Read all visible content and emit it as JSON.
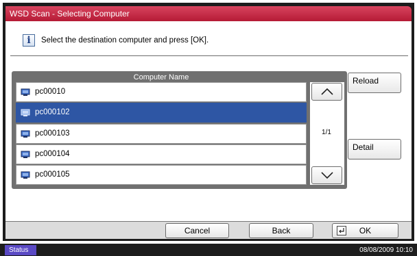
{
  "window": {
    "title": "WSD Scan - Selecting Computer"
  },
  "message": {
    "icon": "info-icon",
    "icon_glyph": "i",
    "text": "Select the destination computer and press [OK]."
  },
  "list": {
    "header": "Computer Name",
    "rows": [
      {
        "label": "pc00010",
        "selected": false,
        "icon": "computer-icon"
      },
      {
        "label": "pc000102",
        "selected": true,
        "icon": "computer-icon"
      },
      {
        "label": "pc000103",
        "selected": false,
        "icon": "computer-icon"
      },
      {
        "label": "pc000104",
        "selected": false,
        "icon": "computer-icon"
      },
      {
        "label": "pc000105",
        "selected": false,
        "icon": "computer-icon"
      }
    ],
    "page_indicator": "1/1",
    "scroll_up_icon": "chevron-up-icon",
    "scroll_down_icon": "chevron-down-icon"
  },
  "side_buttons": {
    "reload": "Reload",
    "detail": "Detail"
  },
  "footer": {
    "cancel": "Cancel",
    "back": "Back",
    "ok": "OK",
    "ok_icon": "enter-icon"
  },
  "statusbar": {
    "status": "Status",
    "datetime": "08/08/2009   10:10"
  },
  "colors": {
    "title_bar": "#c42845",
    "selected_row": "#2e56a4",
    "status_button": "#5a49c4"
  }
}
